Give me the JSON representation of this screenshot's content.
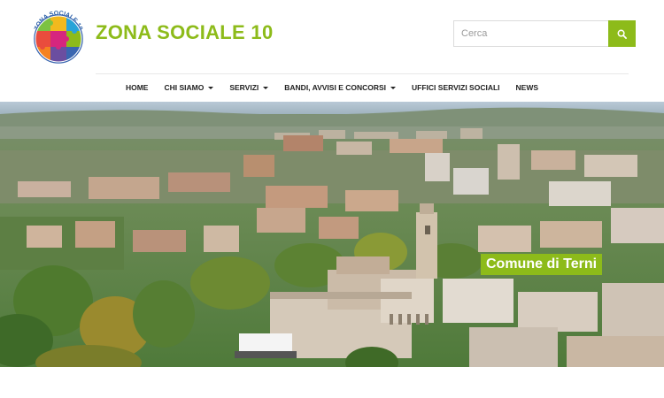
{
  "header": {
    "logo_text": "ZONA SOCIALE 10",
    "site_title": "ZONA SOCIALE 10"
  },
  "search": {
    "placeholder": "Cerca",
    "value": ""
  },
  "nav": {
    "items": [
      {
        "label": "HOME",
        "dropdown": false
      },
      {
        "label": "CHI SIAMO",
        "dropdown": true
      },
      {
        "label": "SERVIZI",
        "dropdown": true
      },
      {
        "label": "BANDI, AVVISI E CONCORSI",
        "dropdown": true
      },
      {
        "label": "UFFICI SERVIZI SOCIALI",
        "dropdown": false
      },
      {
        "label": "NEWS",
        "dropdown": false
      }
    ]
  },
  "hero": {
    "caption": "Comune di Terni"
  },
  "colors": {
    "accent": "#8dbb1a",
    "text": "#222222"
  }
}
